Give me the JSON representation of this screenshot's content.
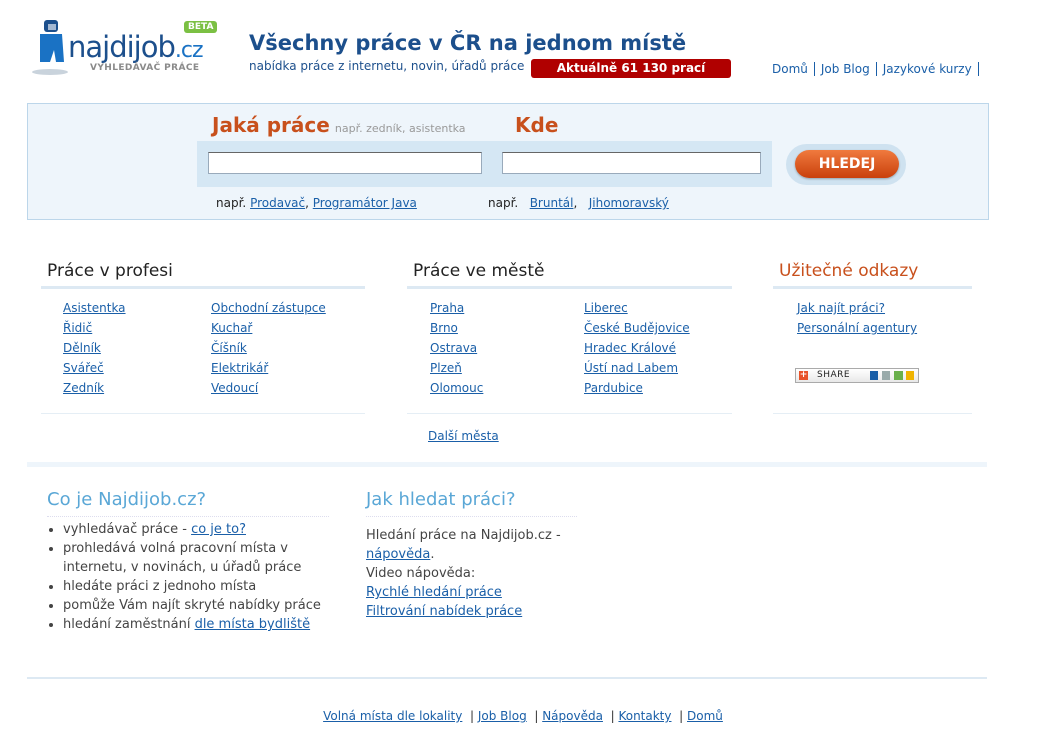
{
  "logo": {
    "wordmark": "najdijob",
    "domain": ".cz",
    "badge": "BETA",
    "tagline": "VYHLEDÁVAČ PRÁCE"
  },
  "header": {
    "headline": "Všechny práce v ČR na jednom místě",
    "subline": "nabídka práce z internetu, novin, úřadů práce",
    "job_count": "Aktuálně 61 130 prací",
    "nav": [
      "Domů",
      "Job Blog",
      "Jazykové kurzy"
    ]
  },
  "search": {
    "what_label": "Jaká práce",
    "what_hint": "např. zedník, asistentka",
    "where_label": "Kde",
    "what_value": "",
    "where_value": "",
    "button": "HLEDEJ",
    "examples_prefix": "např.",
    "what_examples": [
      "Prodavač",
      "Programátor Java"
    ],
    "where_examples": [
      "Bruntál",
      "Jihomoravský"
    ]
  },
  "profese": {
    "title": "Práce v profesi",
    "col1": [
      "Asistentka",
      "Řidič",
      "Dělník",
      "Svářeč",
      "Zedník"
    ],
    "col2": [
      "Obchodní zástupce",
      "Kuchař",
      "Číšník",
      "Elektrikář",
      "Vedoucí"
    ]
  },
  "mesta": {
    "title": "Práce ve městě",
    "col1": [
      "Praha",
      "Brno",
      "Ostrava",
      "Plzeň",
      "Olomouc"
    ],
    "col2": [
      "Liberec",
      "České Budějovice",
      "Hradec Králové",
      "Ústí nad Labem",
      "Pardubice"
    ],
    "more": "Další města"
  },
  "odkazy": {
    "title": "Užitečné odkazy",
    "links": [
      "Jak najít práci?",
      "Personální agentury"
    ],
    "share": "SHARE"
  },
  "about": {
    "title": "Co je Najdijob.cz?",
    "items": [
      {
        "text": "vyhledávač práce - ",
        "link": "co je to?"
      },
      {
        "text": "prohledává volná pracovní místa v internetu, v novinách, u úřadů práce",
        "link": ""
      },
      {
        "text": "hledáte práci z jednoho místa",
        "link": ""
      },
      {
        "text": "pomůže Vám najít skryté nabídky práce",
        "link": ""
      },
      {
        "text": "hledání zaměstnání ",
        "link": "dle místa bydliště"
      }
    ]
  },
  "howto": {
    "title": "Jak hledat práci?",
    "line1": "Hledání práce na Najdijob.cz -",
    "help_link": "nápověda",
    "video_label": "Video nápověda:",
    "video_links": [
      "Rychlé hledání práce",
      "Filtrování nabídek práce"
    ]
  },
  "footer": [
    "Volná místa dle lokality",
    "Job Blog",
    "Nápověda",
    "Kontakty",
    "Domů"
  ]
}
